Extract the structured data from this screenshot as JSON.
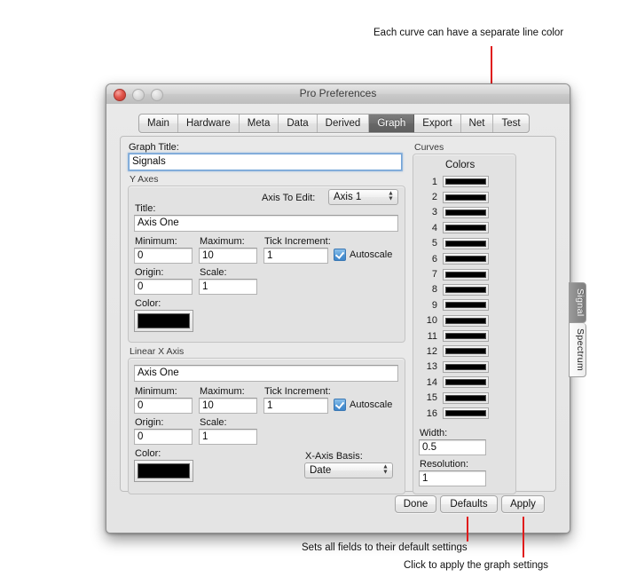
{
  "annotations": {
    "top": "Each curve can have a separate line color",
    "bottom_defaults": "Sets all fields to their default settings",
    "bottom_apply": "Click to apply the graph settings",
    "line_color": "#e01b1b"
  },
  "window": {
    "title": "Pro Preferences",
    "traffic_lights": [
      "close-button",
      "minimize-button",
      "maximize-button"
    ]
  },
  "tabs": [
    {
      "label": "Main",
      "selected": false
    },
    {
      "label": "Hardware",
      "selected": false
    },
    {
      "label": "Meta",
      "selected": false
    },
    {
      "label": "Data",
      "selected": false
    },
    {
      "label": "Derived",
      "selected": false
    },
    {
      "label": "Graph",
      "selected": true
    },
    {
      "label": "Export",
      "selected": false
    },
    {
      "label": "Net",
      "selected": false
    },
    {
      "label": "Test",
      "selected": false
    }
  ],
  "graph_title": {
    "label": "Graph Title:",
    "value": "Signals",
    "focused": true
  },
  "y_axes": {
    "group_label": "Y Axes",
    "axis_to_edit_label": "Axis To Edit:",
    "axis_to_edit_value": "Axis 1",
    "title_label": "Title:",
    "title_value": "Axis One",
    "minimum_label": "Minimum:",
    "minimum_value": "0",
    "maximum_label": "Maximum:",
    "maximum_value": "10",
    "tick_increment_label": "Tick Increment:",
    "tick_increment_value": "1",
    "autoscale_label": "Autoscale",
    "autoscale_checked": true,
    "origin_label": "Origin:",
    "origin_value": "0",
    "scale_label": "Scale:",
    "scale_value": "1",
    "color_label": "Color:",
    "color_value": "#000000"
  },
  "x_axis": {
    "group_label": "Linear X Axis",
    "title_value": "Axis One",
    "minimum_label": "Minimum:",
    "minimum_value": "0",
    "maximum_label": "Maximum:",
    "maximum_value": "10",
    "tick_increment_label": "Tick Increment:",
    "tick_increment_value": "1",
    "autoscale_label": "Autoscale",
    "autoscale_checked": true,
    "origin_label": "Origin:",
    "origin_value": "0",
    "scale_label": "Scale:",
    "scale_value": "1",
    "color_label": "Color:",
    "color_value": "#000000",
    "basis_label": "X-Axis Basis:",
    "basis_value": "Date"
  },
  "curves": {
    "group_label": "Curves",
    "colors_header": "Colors",
    "rows": [
      {
        "num": "1",
        "color": "#000000"
      },
      {
        "num": "2",
        "color": "#000000"
      },
      {
        "num": "3",
        "color": "#000000"
      },
      {
        "num": "4",
        "color": "#000000"
      },
      {
        "num": "5",
        "color": "#000000"
      },
      {
        "num": "6",
        "color": "#000000"
      },
      {
        "num": "7",
        "color": "#000000"
      },
      {
        "num": "8",
        "color": "#000000"
      },
      {
        "num": "9",
        "color": "#000000"
      },
      {
        "num": "10",
        "color": "#000000"
      },
      {
        "num": "11",
        "color": "#000000"
      },
      {
        "num": "12",
        "color": "#000000"
      },
      {
        "num": "13",
        "color": "#000000"
      },
      {
        "num": "14",
        "color": "#000000"
      },
      {
        "num": "15",
        "color": "#000000"
      },
      {
        "num": "16",
        "color": "#000000"
      }
    ],
    "width_label": "Width:",
    "width_value": "0.5",
    "resolution_label": "Resolution:",
    "resolution_value": "1"
  },
  "side_tabs": [
    {
      "label": "Signal",
      "selected": true
    },
    {
      "label": "Spectrum",
      "selected": false
    }
  ],
  "buttons": {
    "done": "Done",
    "defaults": "Defaults",
    "apply": "Apply"
  }
}
